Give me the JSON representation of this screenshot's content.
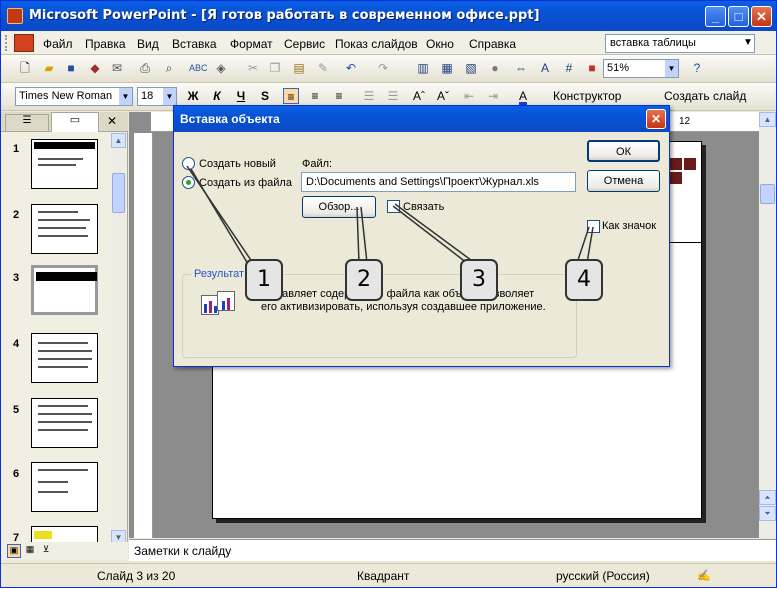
{
  "window": {
    "title": "Microsoft PowerPoint - [Я готов работать в современном офисе.ppt]"
  },
  "menu": {
    "items": [
      "Файл",
      "Правка",
      "Вид",
      "Вставка",
      "Формат",
      "Сервис",
      "Показ слайдов",
      "Окно",
      "Справка"
    ],
    "help_query": "вставка таблицы"
  },
  "toolbar": {
    "zoom": "51%",
    "font": "Times New Roman",
    "font_size": "18",
    "bold": "Ж",
    "italic": "К",
    "underline": "Ч",
    "shadow": "S",
    "designer_label": "Конструктор",
    "new_slide_label": "Создать слайд"
  },
  "panel": {
    "slide_numbers": [
      "1",
      "2",
      "3",
      "4",
      "5",
      "6",
      "7"
    ]
  },
  "ruler": {
    "right_label": "12"
  },
  "notes": {
    "placeholder": "Заметки к слайду"
  },
  "status": {
    "slide": "Слайд 3 из 20",
    "design": "Квадрант",
    "language": "русский (Россия)"
  },
  "dialog": {
    "title": "Вставка объекта",
    "create_new": "Создать новый",
    "create_from_file": "Создать из файла",
    "file_label": "Файл:",
    "file_path": "D:\\Documents and Settings\\Проект\\Журнал.xls",
    "browse": "Обзор...",
    "link": "Связать",
    "as_icon": "Как значок",
    "ok": "ОК",
    "cancel": "Отмена",
    "result_title": "Результат",
    "result_text_1": "...авляет содержимое файла как объект, позволяет",
    "result_text_2": "его активизировать, используя создавшее приложение."
  },
  "callouts": [
    "1",
    "2",
    "3",
    "4"
  ]
}
